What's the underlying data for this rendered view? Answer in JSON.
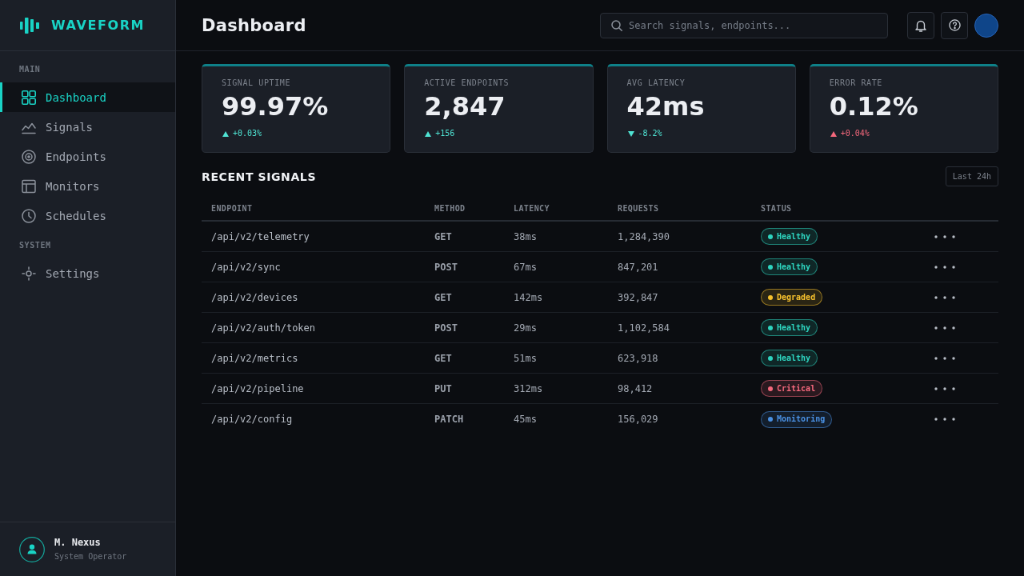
{
  "sidebar": {
    "logo": {
      "text": "WAVEFORM"
    },
    "sections": [
      {
        "heading": "MAIN",
        "items": [
          {
            "label": "Dashboard",
            "selected": true
          },
          {
            "label": "Signals",
            "selected": false
          },
          {
            "label": "Endpoints",
            "selected": false
          },
          {
            "label": "Monitors",
            "selected": false
          },
          {
            "label": "Schedules",
            "selected": false
          }
        ]
      },
      {
        "heading": "SYSTEM",
        "items": [
          {
            "label": "Settings",
            "selected": false
          }
        ]
      }
    ],
    "user": {
      "name": "M. Nexus",
      "role": "System Operator"
    }
  },
  "header": {
    "title": "Dashboard",
    "search": {
      "placeholder": "Search signals, endpoints..."
    }
  },
  "stats": [
    {
      "label": "SIGNAL UPTIME",
      "value": "99.97%",
      "delta": "+0.03%",
      "kind": "up",
      "color": "#4fe3d3"
    },
    {
      "label": "ACTIVE ENDPOINTS",
      "value": "2,847",
      "delta": "+156",
      "kind": "up",
      "color": "#4fe3d3"
    },
    {
      "label": "AVG LATENCY",
      "value": "42ms",
      "delta": "-8.2%",
      "kind": "down",
      "color": "#4fe3d3"
    },
    {
      "label": "ERROR RATE",
      "value": "0.12%",
      "delta": "+0.04%",
      "kind": "up",
      "color": "#f4687c"
    }
  ],
  "recent_signals": {
    "title": "RECENT SIGNALS",
    "range_button": "Last 24h",
    "columns": [
      "ENDPOINT",
      "METHOD",
      "LATENCY",
      "REQUESTS",
      "STATUS"
    ],
    "rows": [
      {
        "endpoint": "/api/v2/telemetry",
        "method": "GET",
        "latency": "38ms",
        "requests": "1,284,390",
        "status": {
          "label": "Healthy",
          "color": "#2dd4bf"
        }
      },
      {
        "endpoint": "/api/v2/sync",
        "method": "POST",
        "latency": "67ms",
        "requests": "847,201",
        "status": {
          "label": "Healthy",
          "color": "#2dd4bf"
        }
      },
      {
        "endpoint": "/api/v2/devices",
        "method": "GET",
        "latency": "142ms",
        "requests": "392,847",
        "status": {
          "label": "Degraded",
          "color": "#f5c02d"
        }
      },
      {
        "endpoint": "/api/v2/auth/token",
        "method": "POST",
        "latency": "29ms",
        "requests": "1,102,584",
        "status": {
          "label": "Healthy",
          "color": "#2dd4bf"
        }
      },
      {
        "endpoint": "/api/v2/metrics",
        "method": "GET",
        "latency": "51ms",
        "requests": "623,918",
        "status": {
          "label": "Healthy",
          "color": "#2dd4bf"
        }
      },
      {
        "endpoint": "/api/v2/pipeline",
        "method": "PUT",
        "latency": "312ms",
        "requests": "98,412",
        "status": {
          "label": "Critical",
          "color": "#f4687c"
        }
      },
      {
        "endpoint": "/api/v2/config",
        "method": "PATCH",
        "latency": "45ms",
        "requests": "156,029",
        "status": {
          "label": "Monitoring",
          "color": "#4a90e2"
        }
      }
    ]
  }
}
